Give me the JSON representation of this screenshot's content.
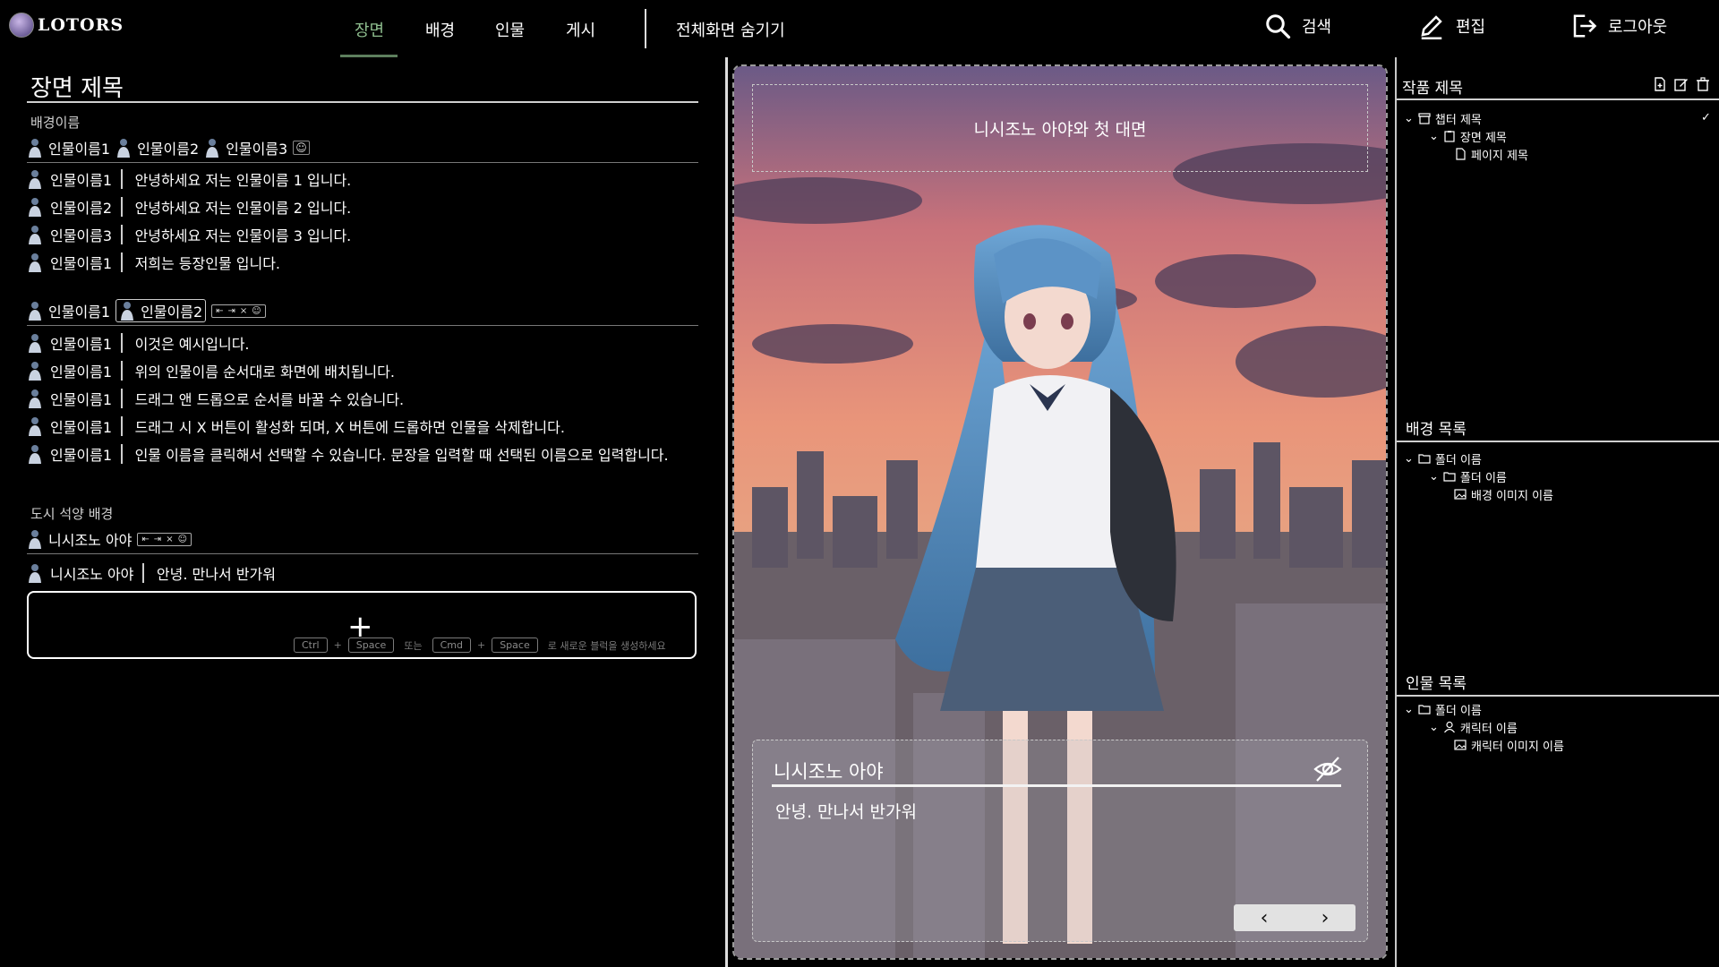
{
  "app": {
    "logo_text": "LOTORS"
  },
  "nav": {
    "tabs": [
      {
        "label": "장면",
        "active": true
      },
      {
        "label": "배경",
        "active": false
      },
      {
        "label": "인물",
        "active": false
      },
      {
        "label": "게시",
        "active": false
      }
    ],
    "fullscreen_label": "전체화면 숨기기",
    "search_label": "검색",
    "edit_label": "편집",
    "logout_label": "로그아웃"
  },
  "editor": {
    "scene_title": "장면 제목",
    "blocks": [
      {
        "background": "배경이름",
        "characters": [
          "인물이름1",
          "인물이름2",
          "인물이름3"
        ],
        "lines": [
          {
            "speaker": "인물이름1",
            "text": "안녕하세요 저는 인물이름 1 입니다."
          },
          {
            "speaker": "인물이름2",
            "text": "안녕하세요 저는 인물이름 2 입니다."
          },
          {
            "speaker": "인물이름3",
            "text": "안녕하세요 저는 인물이름 3 입니다."
          },
          {
            "speaker": "인물이름1",
            "text": "저희는 등장인물 입니다."
          }
        ]
      },
      {
        "background": "",
        "characters": [
          "인물이름1",
          "인물이름2"
        ],
        "lines": [
          {
            "speaker": "인물이름1",
            "text": "이것은 예시입니다."
          },
          {
            "speaker": "인물이름1",
            "text": "위의 인물이름 순서대로 화면에 배치됩니다."
          },
          {
            "speaker": "인물이름1",
            "text": "드래그 앤 드롭으로 순서를 바꿀 수 있습니다."
          },
          {
            "speaker": "인물이름1",
            "text": "드래그 시 X 버튼이 활성화 되며, X 버튼에 드롭하면 인물을 삭제합니다."
          },
          {
            "speaker": "인물이름1",
            "text": "인물 이름을 클릭해서 선택할 수 있습니다. 문장을 입력할 때 선택된 이름으로 입력합니다."
          }
        ]
      },
      {
        "background": "도시 석양 배경",
        "characters": [
          "니시조노 아야"
        ],
        "lines": [
          {
            "speaker": "니시조노 아야",
            "text": "안녕. 만나서 반가워"
          }
        ]
      }
    ],
    "add_hint": {
      "key1": "Ctrl",
      "plus": "+",
      "key2": "Space",
      "or": "또는",
      "key3": "Cmd",
      "key4": "Space",
      "suffix": "로 새로운 블럭을 생성하세요"
    }
  },
  "preview": {
    "scene_caption": "니시조노 아야와 첫 대면",
    "dialog_name": "니시조노 아야",
    "dialog_text": "안녕. 만나서 반가워",
    "prev_icon": "chevron-left-icon",
    "next_icon": "chevron-right-icon"
  },
  "sidebar": {
    "work": {
      "title": "작품 제목",
      "chapter": "챕터 제목",
      "scene": "장면 제목",
      "page": "페이지 제목"
    },
    "backgrounds": {
      "title": "배경 목록",
      "folder": "폴더 이름",
      "subfolder": "폴더 이름",
      "item": "배경 이미지 이름"
    },
    "characters": {
      "title": "인물 목록",
      "folder": "폴더 이름",
      "character": "캐릭터 이름",
      "item": "캐릭터 이미지 이름"
    }
  },
  "colors": {
    "accent": "#8fbf8f",
    "background": "#000000"
  }
}
